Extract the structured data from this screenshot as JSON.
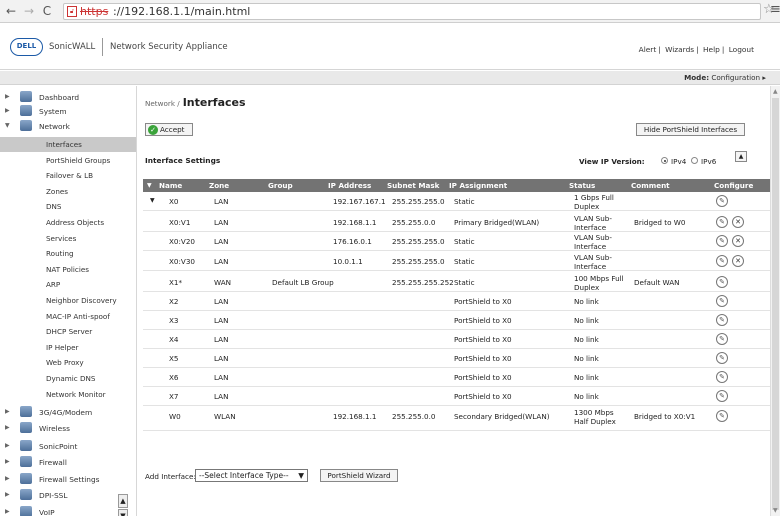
{
  "browser": {
    "scheme": "https",
    "url_rest": "://192.168.1.1/main.html"
  },
  "header": {
    "logo": "DELL",
    "product": "SonicWALL",
    "product_sub": "Network Security Appliance",
    "links": [
      "Alert",
      "Wizards",
      "Help",
      "Logout"
    ]
  },
  "mode": {
    "label": "Mode:",
    "value": "Configuration ▸"
  },
  "sidebar": {
    "top": [
      {
        "label": "Dashboard"
      },
      {
        "label": "System"
      },
      {
        "label": "Network"
      }
    ],
    "network_items": [
      "Interfaces",
      "PortShield Groups",
      "Failover & LB",
      "Zones",
      "DNS",
      "Address Objects",
      "Services",
      "Routing",
      "NAT Policies",
      "ARP",
      "Neighbor Discovery",
      "MAC-IP Anti-spoof",
      "DHCP Server",
      "IP Helper",
      "Web Proxy",
      "Dynamic DNS",
      "Network Monitor"
    ],
    "bottom": [
      "3G/4G/Modem",
      "Wireless",
      "SonicPoint",
      "Firewall",
      "Firewall Settings",
      "DPI-SSL",
      "VoIP"
    ]
  },
  "main": {
    "breadcrumb": "Network /",
    "title": "Interfaces",
    "accept_label": "Accept",
    "hide_label": "Hide PortShield Interfaces",
    "settings_title": "Interface Settings",
    "ip_version_label": "View IP Version:",
    "ipv4": "IPv4",
    "ipv6": "IPv6",
    "columns": [
      "Name",
      "Zone",
      "Group",
      "IP Address",
      "Subnet Mask",
      "IP Assignment",
      "Status",
      "Comment",
      "Configure"
    ],
    "rows": [
      {
        "name": "X0",
        "zone": "LAN",
        "group": "",
        "ip": "192.167.167.1",
        "mask": "255.255.255.0",
        "assign": "Static",
        "status": "1 Gbps Full Duplex",
        "comment": "",
        "del": false,
        "expand": true
      },
      {
        "name": "X0:V1",
        "zone": "LAN",
        "group": "",
        "ip": "192.168.1.1",
        "mask": "255.255.0.0",
        "assign": "Primary Bridged(WLAN)",
        "status": "VLAN Sub-Interface",
        "comment": "Bridged to W0",
        "del": true
      },
      {
        "name": "X0:V20",
        "zone": "LAN",
        "group": "",
        "ip": "176.16.0.1",
        "mask": "255.255.255.0",
        "assign": "Static",
        "status": "VLAN Sub-Interface",
        "comment": "",
        "del": true
      },
      {
        "name": "X0:V30",
        "zone": "LAN",
        "group": "",
        "ip": "10.0.1.1",
        "mask": "255.255.255.0",
        "assign": "Static",
        "status": "VLAN Sub-Interface",
        "comment": "",
        "del": true
      },
      {
        "name": "X1*",
        "zone": "WAN",
        "group": "Default LB Group",
        "ip": "",
        "mask": "255.255.255.252",
        "assign": "Static",
        "status": "100 Mbps Full Duplex",
        "comment": "Default WAN",
        "del": false
      },
      {
        "name": "X2",
        "zone": "LAN",
        "group": "",
        "ip": "",
        "mask": "",
        "assign": "PortShield to X0",
        "status": "No link",
        "comment": "",
        "del": false
      },
      {
        "name": "X3",
        "zone": "LAN",
        "group": "",
        "ip": "",
        "mask": "",
        "assign": "PortShield to X0",
        "status": "No link",
        "comment": "",
        "del": false
      },
      {
        "name": "X4",
        "zone": "LAN",
        "group": "",
        "ip": "",
        "mask": "",
        "assign": "PortShield to X0",
        "status": "No link",
        "comment": "",
        "del": false
      },
      {
        "name": "X5",
        "zone": "LAN",
        "group": "",
        "ip": "",
        "mask": "",
        "assign": "PortShield to X0",
        "status": "No link",
        "comment": "",
        "del": false
      },
      {
        "name": "X6",
        "zone": "LAN",
        "group": "",
        "ip": "",
        "mask": "",
        "assign": "PortShield to X0",
        "status": "No link",
        "comment": "",
        "del": false
      },
      {
        "name": "X7",
        "zone": "LAN",
        "group": "",
        "ip": "",
        "mask": "",
        "assign": "PortShield to X0",
        "status": "No link",
        "comment": "",
        "del": false
      },
      {
        "name": "W0",
        "zone": "WLAN",
        "group": "",
        "ip": "192.168.1.1",
        "mask": "255.255.0.0",
        "assign": "Secondary Bridged(WLAN)",
        "status": "1300 Mbps Half Duplex",
        "comment": "Bridged to X0:V1",
        "del": false
      }
    ],
    "add_interface_label": "Add Interface:",
    "add_interface_select": "--Select Interface Type--",
    "portshield_wizard": "PortShield Wizard"
  }
}
